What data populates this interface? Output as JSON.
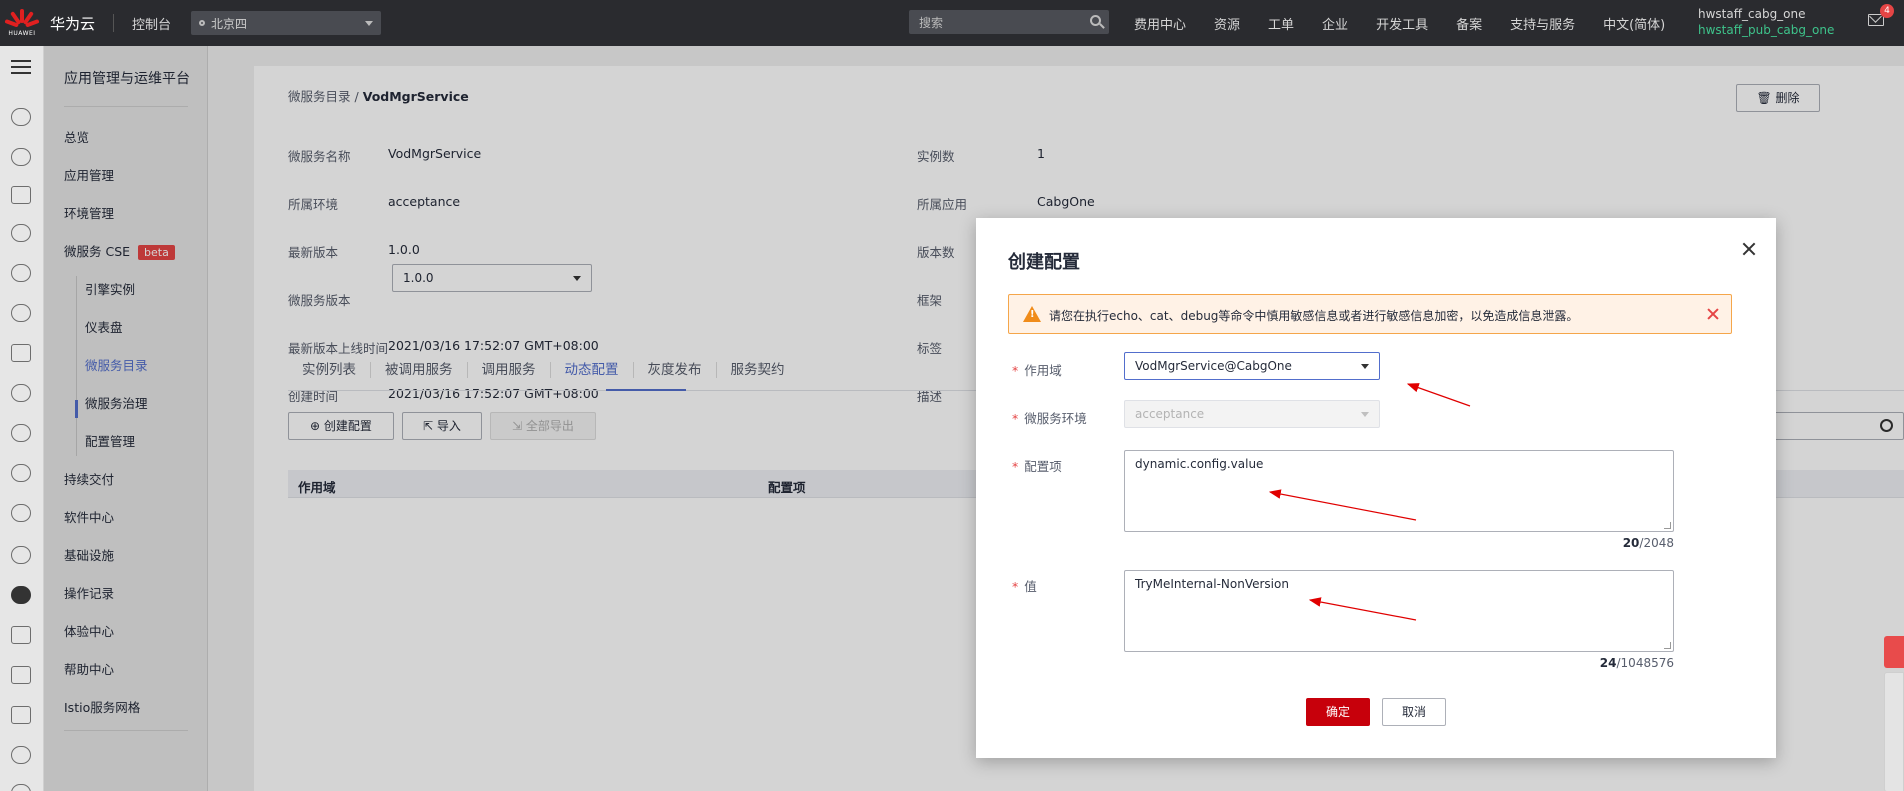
{
  "topbar": {
    "brand": "华为云",
    "logo_text": "HUAWEI",
    "console": "控制台",
    "region": "北京四",
    "search_placeholder": "搜索",
    "nav": [
      "费用中心",
      "资源",
      "工单",
      "企业",
      "开发工具",
      "备案",
      "支持与服务",
      "中文(简体)"
    ],
    "user_main": "hwstaff_cabg_one",
    "user_sub": "hwstaff_pub_cabg_one",
    "mail_badge": "4"
  },
  "menu": {
    "title": "应用管理与运维平台",
    "items": [
      {
        "label": "总览"
      },
      {
        "label": "应用管理"
      },
      {
        "label": "环境管理"
      },
      {
        "label": "微服务 CSE",
        "badge": "beta"
      },
      {
        "label": "引擎实例"
      },
      {
        "label": "仪表盘"
      },
      {
        "label": "微服务目录"
      },
      {
        "label": "微服务治理"
      },
      {
        "label": "配置管理"
      },
      {
        "label": "持续交付"
      },
      {
        "label": "软件中心"
      },
      {
        "label": "基础设施"
      },
      {
        "label": "操作记录"
      },
      {
        "label": "体验中心"
      },
      {
        "label": "帮助中心"
      },
      {
        "label": "Istio服务网格"
      }
    ]
  },
  "page": {
    "breadcrumb_parent": "微服务目录",
    "breadcrumb_sep": "/",
    "breadcrumb_current": "VodMgrService",
    "delete_label": "删除",
    "fields_left": [
      {
        "label": "微服务名称",
        "value": "VodMgrService"
      },
      {
        "label": "所属环境",
        "value": "acceptance"
      },
      {
        "label": "最新版本",
        "value": "1.0.0"
      },
      {
        "label": "微服务版本",
        "value": "1.0.0"
      },
      {
        "label": "最新版本上线时间",
        "value": "2021/03/16 17:52:07 GMT+08:00"
      },
      {
        "label": "创建时间",
        "value": "2021/03/16 17:52:07 GMT+08:00"
      }
    ],
    "fields_right": [
      {
        "label": "实例数",
        "value": "1"
      },
      {
        "label": "所属应用",
        "value": "CabgOne"
      },
      {
        "label": "版本数",
        "value": ""
      },
      {
        "label": "框架",
        "value": ""
      },
      {
        "label": "标签",
        "value": ""
      },
      {
        "label": "描述",
        "value": ""
      }
    ],
    "tabs": [
      "实例列表",
      "被调用服务",
      "调用服务",
      "动态配置",
      "灰度发布",
      "服务契约"
    ],
    "create_btn": "创建配置",
    "import_btn": "导入",
    "export_btn": "全部导出",
    "table_headers": [
      "作用域",
      "配置项"
    ]
  },
  "dialog": {
    "title": "创建配置",
    "alert": "请您在执行echo、cat、debug等命令中慎用敏感信息或者进行敏感信息加密，以免造成信息泄露。",
    "scope_label": "作用域",
    "scope_value": "VodMgrService@CabgOne",
    "env_label": "微服务环境",
    "env_value": "acceptance",
    "key_label": "配置项",
    "key_value": "dynamic.config.value",
    "key_count": "20",
    "key_max": "/2048",
    "value_label": "值",
    "value_value": "TryMeInternal-NonVersion",
    "value_count": "24",
    "value_max": "/1048576",
    "ok_label": "确定",
    "cancel_label": "取消"
  },
  "colors": {
    "accent": "#526ecc",
    "primary_button": "#c7000b",
    "warning": "#f08c1a",
    "annotation_arrow": "#e00000"
  }
}
